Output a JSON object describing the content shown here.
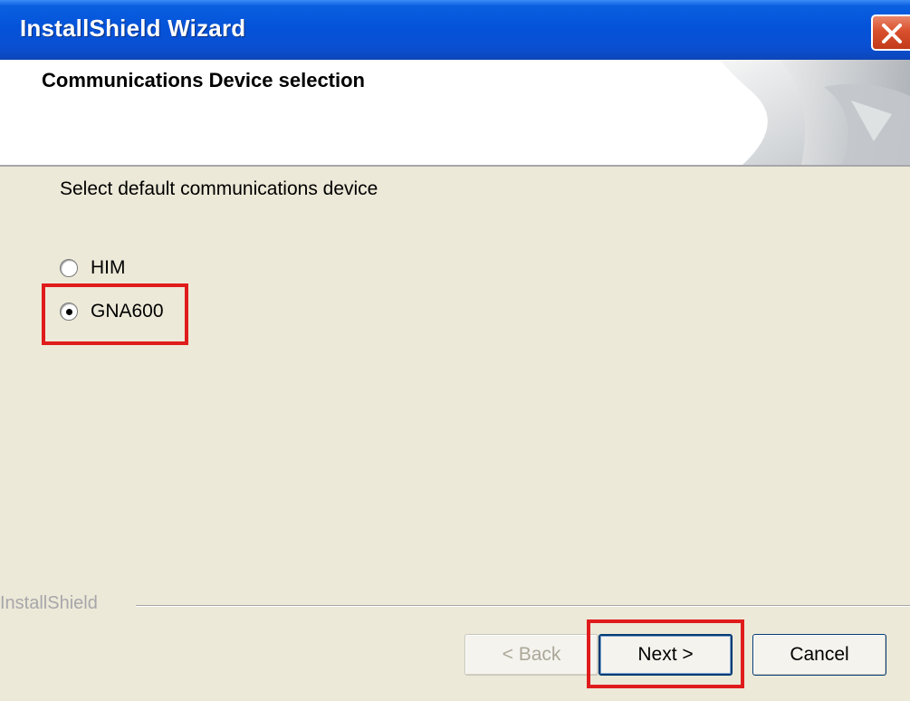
{
  "window": {
    "title": "InstallShield Wizard"
  },
  "header": {
    "title": "Communications Device selection"
  },
  "body": {
    "instruction": "Select default communications device",
    "options": [
      {
        "label": "HIM",
        "selected": false
      },
      {
        "label": "GNA600",
        "selected": true
      }
    ]
  },
  "footer": {
    "brand": "InstallShield",
    "back_label": "< Back",
    "next_label": "Next >",
    "cancel_label": "Cancel"
  },
  "colors": {
    "highlight": "#E01B1B",
    "titlebar": "#0453D9",
    "dialog_bg": "#ECE9D8"
  },
  "icons": {
    "close": "close-icon"
  }
}
